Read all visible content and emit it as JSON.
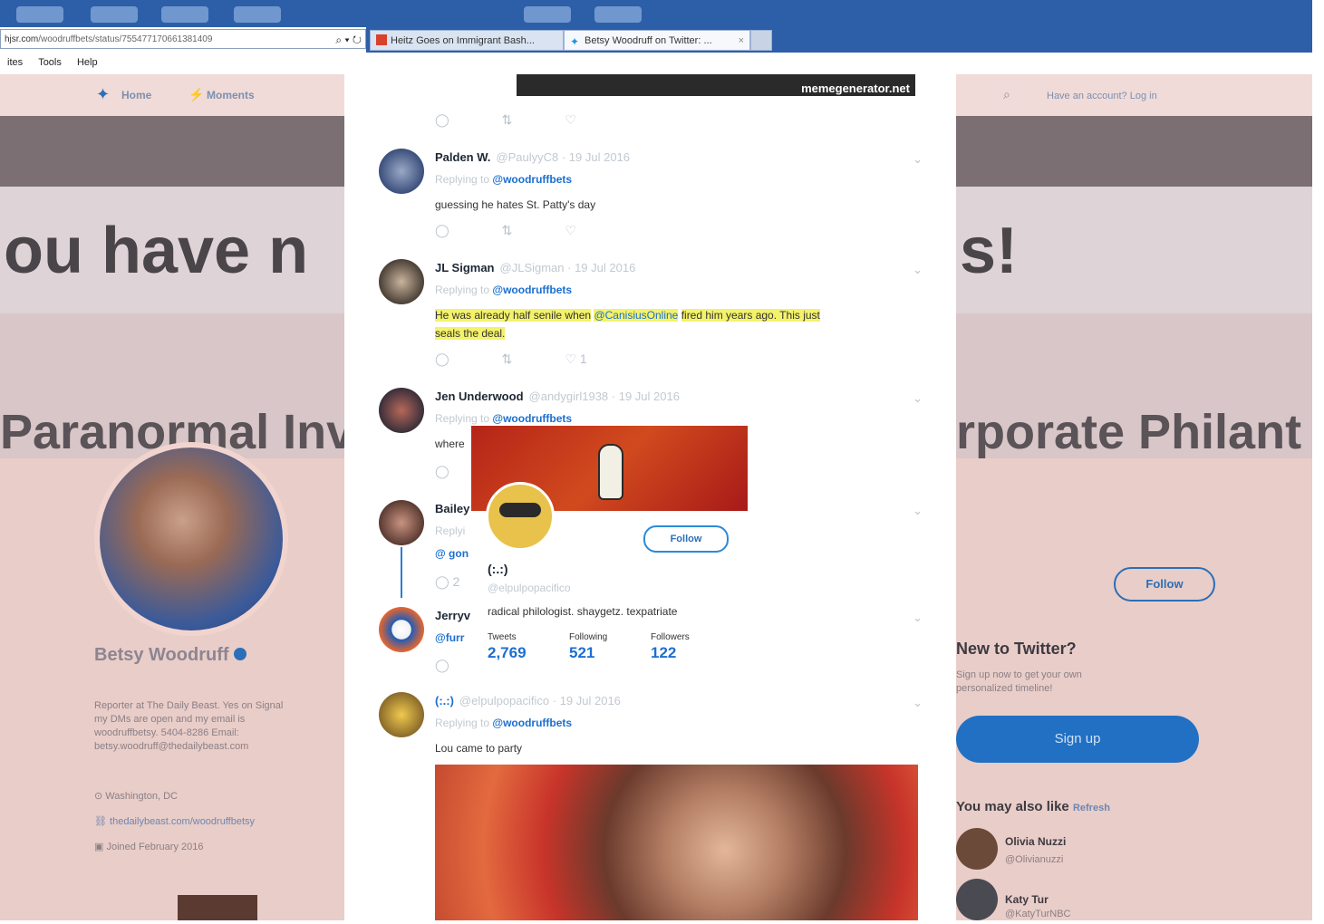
{
  "browser": {
    "address": "hjsr.com",
    "address_rest": "/woodruffbets/status/755477170661381409",
    "tabs": [
      {
        "label": "Heitz Goes on Immigrant Bash..."
      },
      {
        "label": "Betsy Woodruff on Twitter: ..."
      }
    ],
    "menu": [
      "ites",
      "Tools",
      "Help"
    ]
  },
  "left_bg": {
    "nav": [
      "Home",
      "Moments"
    ],
    "headline": "ou have n",
    "subline": "Paranormal Inv",
    "profile_name": "Betsy Woodruff",
    "bio": [
      "Reporter at The Daily Beast. Yes on Signal",
      "my DMs are open and my email is",
      "woodruffbetsy. 5404-8286 Email:",
      "betsy.woodruff@thedailybeast.com"
    ],
    "location": "Washington, DC",
    "link": "thedailybeast.com/woodruffbetsy",
    "joined": "Joined February 2016"
  },
  "right_bg": {
    "nav_text": "Have an account? Log in",
    "headline": "s!",
    "subline": "rporate Philant",
    "follow": "Follow",
    "new_title": "New to Twitter?",
    "new_text": [
      "Sign up now to get your own",
      "personalized timeline!"
    ],
    "signup": "Sign up",
    "also_like": "You may also like",
    "refresh": "Refresh",
    "suggest": [
      {
        "name": "Olivia Nuzzi",
        "handle": "@Olivianuzzi"
      },
      {
        "name": "Katy Tur",
        "handle": "@KatyTurNBC"
      }
    ]
  },
  "tweets": {
    "meme_caption": "memegenerator.net",
    "items": [
      {
        "name": "Palden W.",
        "meta": "@PaulyyC8 · 19 Jul 2016",
        "replying": "Replying to",
        "mention": "@woodruffbets",
        "text": "guessing he hates St. Patty's day"
      },
      {
        "name": "JL Sigman",
        "meta": "@JLSigman · 19 Jul 2016",
        "replying": "Replying to",
        "mention": "@woodruffbets",
        "text_a": "He was already half senile when",
        "text_link": "@CanisiusOnline",
        "text_b": "fired him years ago. This just",
        "text_c": "seals the deal.",
        "likes": "1"
      },
      {
        "name": "Jen Underwood",
        "meta": "@andygirl1938 · 19 Jul 2016",
        "replying": "Replying to",
        "mention": "@woodruffbets",
        "text": "where"
      },
      {
        "name": "Bailey",
        "replying": "Replyi",
        "mention": "@ gon",
        "replies": "2"
      },
      {
        "name": "Jerryv",
        "mention": "@furr"
      },
      {
        "name": "(:.:)",
        "meta": "@elpulpopacifico · 19 Jul 2016",
        "replying": "Replying to",
        "mention": "@woodruffbets",
        "text": "Lou came to party"
      }
    ]
  },
  "hover_card": {
    "follow": "Follow",
    "name": "(:.:)",
    "handle": "@elpulpopacifico",
    "bio": "radical philologist. shaygetz. texpatriate",
    "stats": [
      {
        "label": "Tweets",
        "value": "2,769"
      },
      {
        "label": "Following",
        "value": "521"
      },
      {
        "label": "Followers",
        "value": "122"
      }
    ]
  },
  "colors": {
    "twitter_blue": "#1b6fd1",
    "highlight": "#f4f26a",
    "chrome_blue": "#2d5fa8"
  }
}
